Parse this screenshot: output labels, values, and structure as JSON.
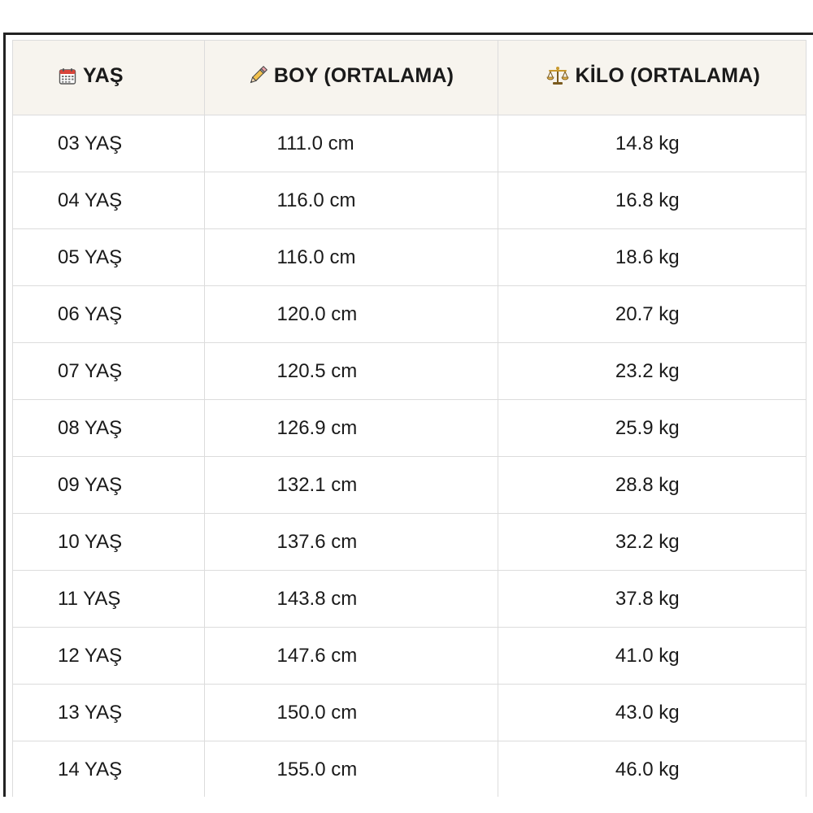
{
  "table": {
    "headers": {
      "age": "YAŞ",
      "height": "BOY (ORTALAMA)",
      "weight": "KİLO (ORTALAMA)"
    },
    "header_icons": {
      "age": "calendar-icon",
      "height": "pencil-icon",
      "weight": "scale-icon"
    },
    "rows": [
      {
        "age": "03 YAŞ",
        "height": "111.0 cm",
        "weight": "14.8 kg"
      },
      {
        "age": "04 YAŞ",
        "height": "116.0 cm",
        "weight": "16.8 kg"
      },
      {
        "age": "05 YAŞ",
        "height": "116.0 cm",
        "weight": "18.6 kg"
      },
      {
        "age": "06 YAŞ",
        "height": "120.0 cm",
        "weight": "20.7 kg"
      },
      {
        "age": "07 YAŞ",
        "height": "120.5 cm",
        "weight": "23.2 kg"
      },
      {
        "age": "08 YAŞ",
        "height": "126.9 cm",
        "weight": "25.9 kg"
      },
      {
        "age": "09 YAŞ",
        "height": "132.1 cm",
        "weight": "28.8 kg"
      },
      {
        "age": "10 YAŞ",
        "height": "137.6 cm",
        "weight": "32.2 kg"
      },
      {
        "age": "11 YAŞ",
        "height": "143.8 cm",
        "weight": "37.8 kg"
      },
      {
        "age": "12 YAŞ",
        "height": "147.6 cm",
        "weight": "41.0 kg"
      },
      {
        "age": "13 YAŞ",
        "height": "150.0 cm",
        "weight": "43.0 kg"
      },
      {
        "age": "14 YAŞ",
        "height": "155.0 cm",
        "weight": "46.0 kg"
      }
    ]
  }
}
